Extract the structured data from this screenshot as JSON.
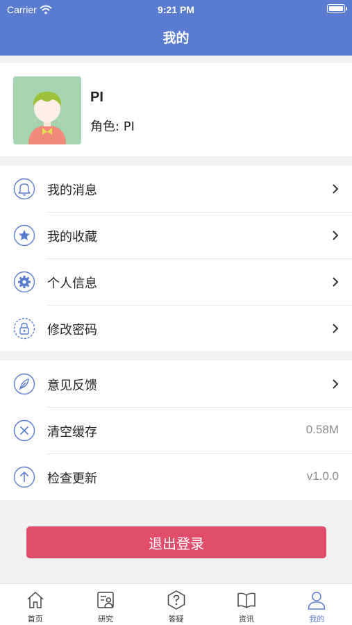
{
  "status_bar": {
    "carrier": "Carrier",
    "time": "9:21 PM"
  },
  "nav": {
    "title": "我的"
  },
  "profile": {
    "name": "PI",
    "role": "角色: PI"
  },
  "menu_group_1": [
    {
      "label": "我的消息",
      "icon": "bell-icon"
    },
    {
      "label": "我的收藏",
      "icon": "star-icon"
    },
    {
      "label": "个人信息",
      "icon": "gear-icon"
    },
    {
      "label": "修改密码",
      "icon": "lock-icon"
    }
  ],
  "menu_group_2": [
    {
      "label": "意见反馈",
      "icon": "feather-icon",
      "value": ""
    },
    {
      "label": "清空缓存",
      "icon": "clear-icon",
      "value": "0.58M"
    },
    {
      "label": "检查更新",
      "icon": "upload-icon",
      "value": "v1.0.0"
    }
  ],
  "logout_label": "退出登录",
  "tabs": [
    {
      "label": "首页",
      "icon": "home-icon"
    },
    {
      "label": "研究",
      "icon": "research-icon"
    },
    {
      "label": "答疑",
      "icon": "question-icon"
    },
    {
      "label": "资讯",
      "icon": "book-icon"
    },
    {
      "label": "我的",
      "icon": "user-icon",
      "active": true
    }
  ],
  "colors": {
    "primary": "#5a7cd0",
    "logout": "#e04e6c",
    "background": "#f2f2f5",
    "muted_text": "#8a8a8f"
  }
}
